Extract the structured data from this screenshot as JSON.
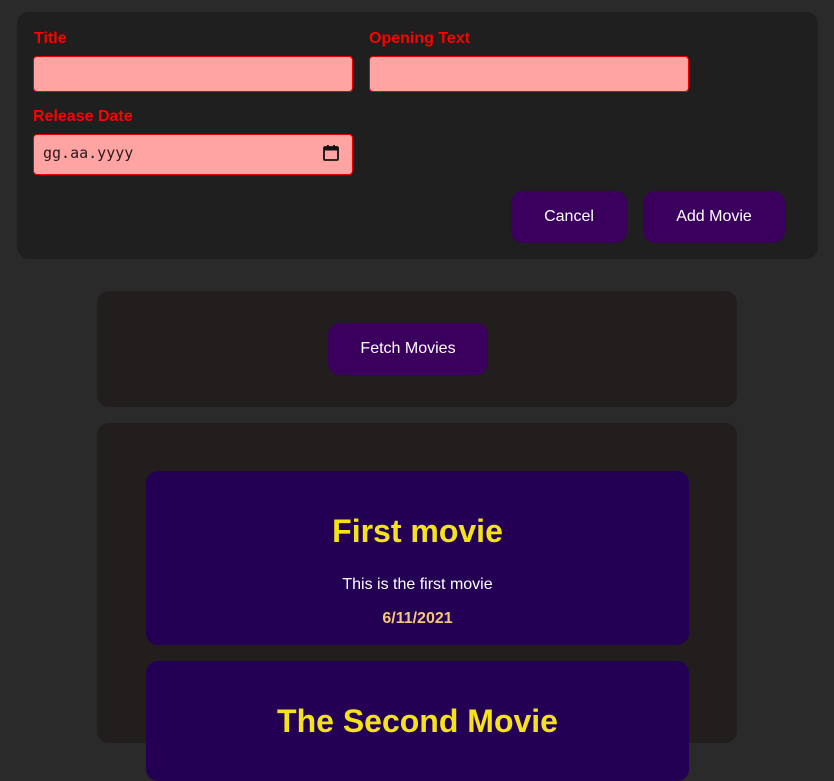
{
  "form": {
    "title_label": "Title",
    "opening_text_label": "Opening Text",
    "release_date_label": "Release Date",
    "title_value": "",
    "opening_text_value": "",
    "release_date_placeholder": "gg.aa.yyyy",
    "cancel_label": "Cancel",
    "add_movie_label": "Add Movie"
  },
  "fetch": {
    "button_label": "Fetch Movies"
  },
  "movies": [
    {
      "title": "First movie",
      "opening_text": "This is the first movie",
      "release_date": "6/11/2021"
    },
    {
      "title": "The Second Movie"
    }
  ],
  "colors": {
    "background": "#2a2a2a",
    "label_red": "#ff0000",
    "field_fill": "#ffa3a3",
    "button_purple": "#3b005e",
    "movie_card": "#230053",
    "movie_title_yellow": "#f5e31a",
    "movie_date": "#f5c77a"
  },
  "icons": {
    "date_picker": "calendar-icon"
  }
}
